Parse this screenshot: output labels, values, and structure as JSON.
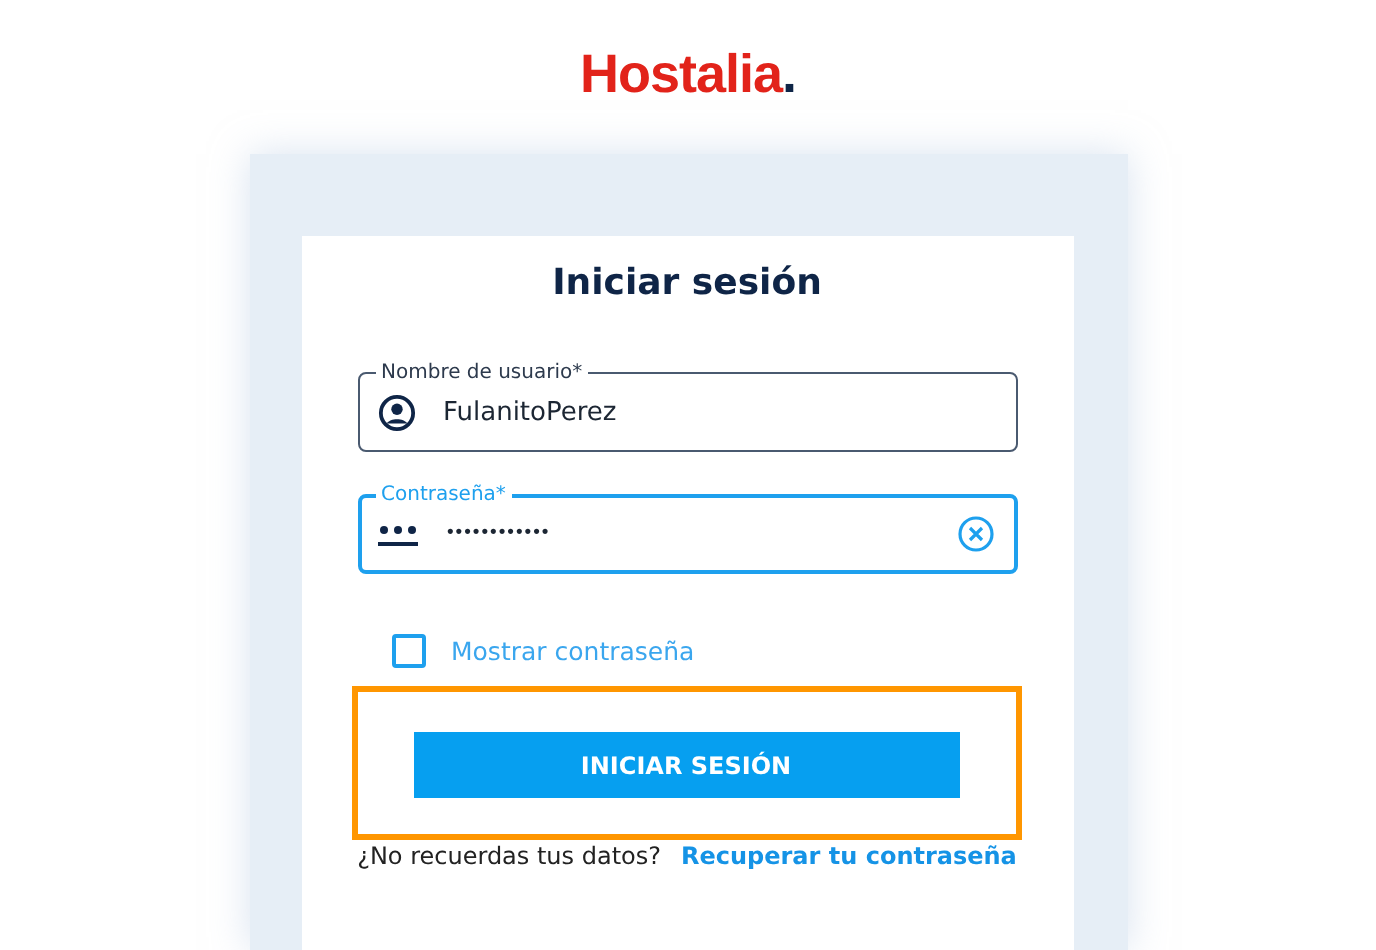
{
  "logo": {
    "name": "Hostalia",
    "mark": "."
  },
  "form": {
    "title": "Iniciar sesión",
    "fields": [
      {
        "kind": "user",
        "label": "Nombre de usuario*",
        "value": "FulanitoPerez",
        "focused": false
      },
      {
        "kind": "password",
        "label": "Contraseña*",
        "value": "••••••••••••",
        "focused": true
      }
    ],
    "show_password": {
      "label": "Mostrar contraseña",
      "checked": false
    },
    "submit": {
      "label": "INICIAR SESIÓN",
      "highlighted": true
    },
    "help": {
      "text": "¿No recuerdas tus datos?",
      "link": "Recuperar tu contraseña"
    }
  }
}
